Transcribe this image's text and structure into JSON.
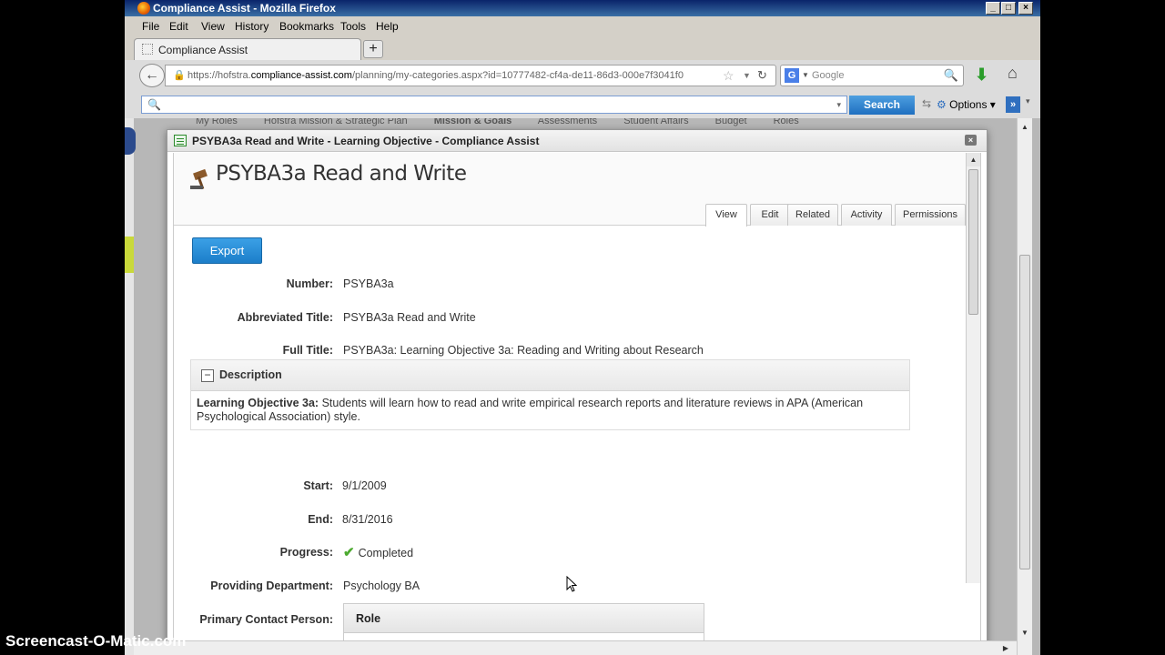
{
  "window": {
    "title": "Compliance Assist - Mozilla Firefox",
    "controls": {
      "minimize": "_",
      "maximize": "□",
      "close": "×"
    }
  },
  "menu": [
    "File",
    "Edit",
    "View",
    "History",
    "Bookmarks",
    "Tools",
    "Help"
  ],
  "tabs": [
    {
      "label": "Compliance Assist"
    }
  ],
  "newtab_label": "+",
  "address": {
    "prefix": "https://hofstra.",
    "domain": "compliance-assist.com",
    "suffix": "/planning/my-categories.aspx?id=10777482-cf4a-de11-86d3-000e7f3041f0"
  },
  "search_engine": {
    "icon": "G",
    "placeholder": "Google"
  },
  "toolbar": {
    "search_button": "Search",
    "options_label": "Options"
  },
  "background_nav": [
    "My Roles",
    "Hofstra Mission & Strategic Plan",
    "Mission & Goals",
    "Assessments",
    "Student Affairs",
    "Budget",
    "Roles"
  ],
  "dialog": {
    "title": "PSYBA3a Read and Write - Learning Objective - Compliance Assist",
    "close": "×",
    "record_title": "PSYBA3a Read and Write",
    "tabs": [
      "View",
      "Edit",
      "Related",
      "Activity",
      "Permissions"
    ],
    "active_tab": "View",
    "export_label": "Export",
    "fields": {
      "number": {
        "label": "Number:",
        "value": "PSYBA3a"
      },
      "abbreviated_title": {
        "label": "Abbreviated Title:",
        "value": "PSYBA3a Read and Write"
      },
      "full_title": {
        "label": "Full Title:",
        "value": "PSYBA3a: Learning Objective 3a: Reading and Writing about Research"
      }
    },
    "description": {
      "toggle": "−",
      "header": "Description",
      "lead": "Learning Objective 3a:",
      "text": "Students will learn how to read and write empirical research reports and literature reviews in APA (American Psychological Association) style."
    },
    "fields2": {
      "start": {
        "label": "Start:",
        "value": "9/1/2009"
      },
      "end": {
        "label": "End:",
        "value": "8/31/2016"
      },
      "progress": {
        "label": "Progress:",
        "value": "Completed",
        "icon": "check-icon"
      },
      "providing_department": {
        "label": "Providing Department:",
        "value": "Psychology BA"
      },
      "primary_contact": {
        "label": "Primary Contact Person:",
        "table_header": "Role"
      }
    }
  },
  "watermark": "Screencast-O-Matic.com",
  "colors": {
    "accent": "#1f7fc9",
    "check": "#4caa2f",
    "titlebar": "#0a246a"
  }
}
